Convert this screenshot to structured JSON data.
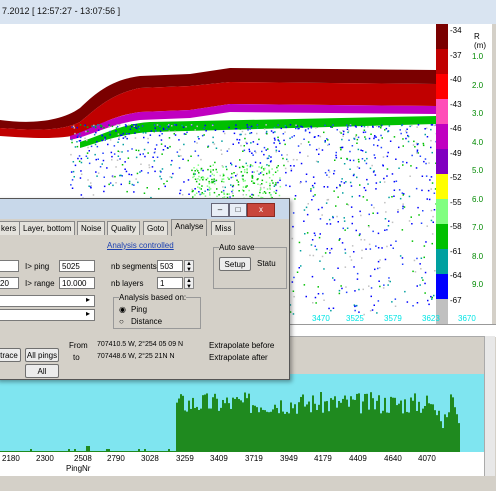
{
  "window": {
    "title": "7.2012 [ 12:57:27 - 13:07:56 ]"
  },
  "echogram": {
    "depth_unit_label": "R (m)",
    "depth_labels": [
      "1.0",
      "2.0",
      "3.0",
      "4.0",
      "5.0",
      "6.0",
      "7.0",
      "8.0",
      "9.0"
    ],
    "db_labels": [
      "-34",
      "-37",
      "-40",
      "-43",
      "-46",
      "-49",
      "-52",
      "-55",
      "-58",
      "-61",
      "-64",
      "-67"
    ],
    "x_ticks": [
      "3470",
      "3525",
      "3579",
      "3623",
      "3670"
    ],
    "colors": [
      "#7a0000",
      "#c00000",
      "#ff0000",
      "#ff4db8",
      "#c000c0",
      "#8000c0",
      "#ffff00",
      "#80ff80",
      "#00c000",
      "#00a0a0",
      "#0000ff",
      "#c0c0c0"
    ]
  },
  "dialog": {
    "controls": {
      "minimize": "–",
      "maximize": "□",
      "close": "x"
    },
    "tabs": [
      "kers",
      "Layer, bottom",
      "Noise",
      "Quality",
      "Goto",
      "Analyse",
      "Miss"
    ],
    "active_tab": "Analyse",
    "analysis_controlled_link": "Analysis controlled",
    "ping_label": "I> ping",
    "ping_value": "5025",
    "range_label": "I> range",
    "range_value": "10.000",
    "left_value": "20",
    "segments_label": "nb segments",
    "segments_value": "503",
    "layers_label": "nb layers",
    "layers_value": "1",
    "based_on_title": "Analysis based on:",
    "option_ping": "Ping",
    "option_distance": "Distance",
    "auto_save_title": "Auto save",
    "setup_button": "Setup",
    "status_label": "Statu",
    "from_label": "From",
    "from_coords": "707410.5 W, 2°254 05 09 N",
    "to_label": "to",
    "to_coords": "707448.6 W, 2°25 21N N",
    "extrapolate_before": "Extrapolate before",
    "extrapolate_after": "Extrapolate after",
    "trace_button": "trace",
    "all_pings_button": "All pings",
    "all_button": "All"
  },
  "histogram": {
    "x_labels": [
      "2180",
      "2300",
      "2508",
      "2790",
      "3028",
      "3259",
      "3409",
      "3719",
      "3949",
      "4179",
      "4409",
      "4640",
      "4070"
    ],
    "x_title": "PingNr"
  }
}
